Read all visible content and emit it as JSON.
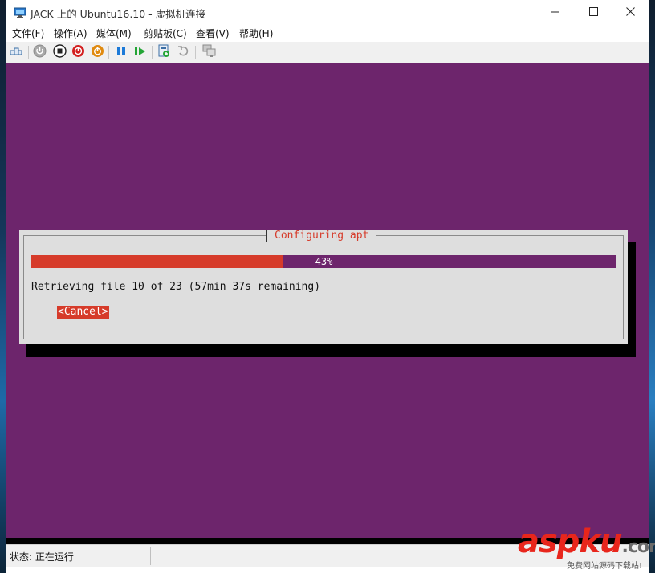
{
  "window": {
    "title": "JACK 上的 Ubuntu16.10 - 虚拟机连接",
    "minimize_icon": "minimize-icon",
    "maximize_icon": "maximize-icon",
    "close_icon": "close-icon"
  },
  "menu": {
    "items": [
      {
        "label": "文件(F)"
      },
      {
        "label": "操作(A)"
      },
      {
        "label": "媒体(M)"
      },
      {
        "label": "剪贴板(C)"
      },
      {
        "label": "查看(V)"
      },
      {
        "label": "帮助(H)"
      }
    ]
  },
  "toolbar": {
    "icons": [
      "ctrl-alt-del-icon",
      "start-icon",
      "turn-off-icon",
      "shutdown-icon",
      "save-icon",
      "pause-icon",
      "resume-icon",
      "checkpoint-icon",
      "revert-icon",
      "enhanced-session-icon"
    ],
    "colors": {
      "stop": "#d32020",
      "save": "#e08a10",
      "pause": "#1c7ad8",
      "resume": "#23a535"
    }
  },
  "installer": {
    "dialog_title": "Configuring apt",
    "progress_percent": 43,
    "progress_label": "43%",
    "status_text": "Retrieving file 10 of 23 (57min 37s remaining)",
    "cancel_label": "<Cancel>",
    "colors": {
      "background": "#6d256c",
      "accent": "#d63b2a",
      "dialog": "#dedede"
    }
  },
  "statusbar": {
    "status": "状态: 正在运行"
  },
  "watermark": {
    "brand": "aspku",
    "suffix": ".com",
    "subtitle": "免费网站源码下载站!"
  }
}
